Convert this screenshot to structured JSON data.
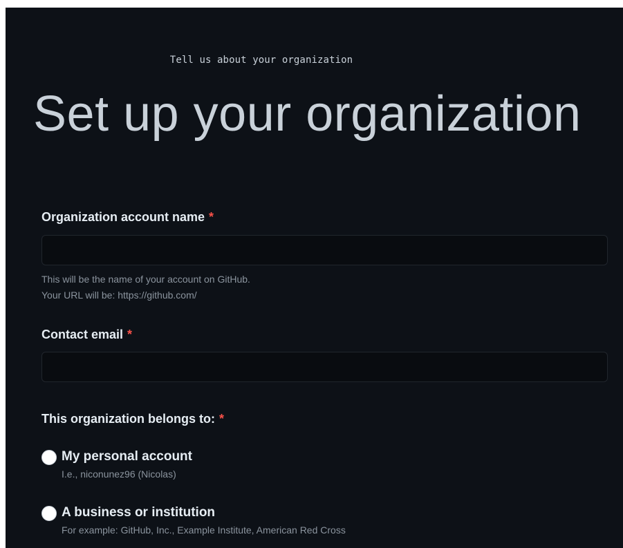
{
  "kicker": "Tell us about your organization",
  "title": "Set up your organization",
  "required_marker": "*",
  "org_name": {
    "label": "Organization account name",
    "value": "",
    "placeholder": "",
    "hint_line1": "This will be the name of your account on GitHub.",
    "hint_line2": "Your URL will be: https://github.com/"
  },
  "contact_email": {
    "label": "Contact email",
    "value": "",
    "placeholder": ""
  },
  "belongs_to": {
    "label": "This organization belongs to:",
    "options": [
      {
        "title": "My personal account",
        "description": "I.e., niconunez96 (Nicolas)",
        "selected": false
      },
      {
        "title": "A business or institution",
        "description": "For example: GitHub, Inc., Example Institute, American Red Cross",
        "selected": false
      }
    ]
  },
  "colors": {
    "background": "#0d1117",
    "text": "#c9d1d9",
    "muted": "#8b949e",
    "required": "#f85149",
    "input_bg": "#090c10",
    "input_border": "#21262d"
  }
}
